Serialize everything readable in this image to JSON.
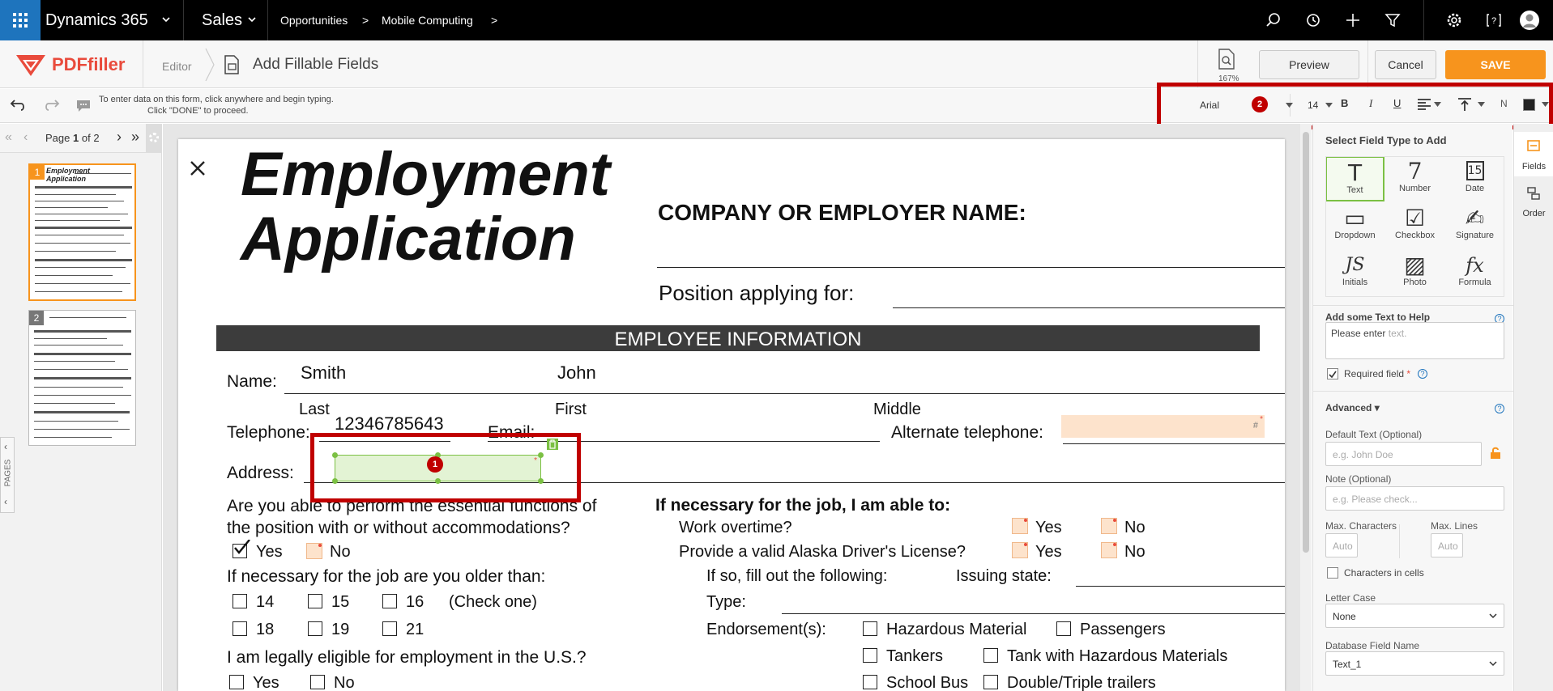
{
  "topnav": {
    "app_name": "Dynamics 365",
    "module": "Sales",
    "breadcrumb": [
      "Opportunities",
      "Mobile Computing"
    ]
  },
  "header": {
    "logo_text": "PDFfiller",
    "editor_label": "Editor",
    "page_title": "Add Fillable Fields",
    "zoom": "167%",
    "preview_label": "Preview",
    "cancel_label": "Cancel",
    "save_label": "SAVE"
  },
  "toolbar": {
    "hint_line1": "To enter data on this form, click anywhere and begin typing.",
    "hint_line2": "Click \"DONE\" to proceed.",
    "font": "Arial",
    "font_size": "14",
    "bold": "B",
    "italic": "I",
    "underline": "U",
    "n_label": "N",
    "annotation_badge": "2"
  },
  "pagenav": {
    "prefix": "Page",
    "current": "1",
    "suffix": "of 2"
  },
  "thumbnails": [
    {
      "num": "1",
      "title": "Employment Application"
    },
    {
      "num": "2",
      "title": ""
    }
  ],
  "pages_tab_label": "PAGES",
  "document": {
    "title_line1": "Employment",
    "title_line2": "Application",
    "company_label": "COMPANY OR EMPLOYER NAME:",
    "position_label": "Position applying for:",
    "section_header": "EMPLOYEE INFORMATION",
    "name_label": "Name:",
    "name_last_value": "Smith",
    "name_first_value": "John",
    "last_caption": "Last",
    "first_caption": "First",
    "middle_caption": "Middle",
    "telephone_label": "Telephone:",
    "telephone_value": "12346785643",
    "email_label": "Email:",
    "alt_tel_label": "Alternate telephone:",
    "alt_field_hash": "#",
    "address_label": "Address:",
    "address_badge": "1",
    "q_able_line1": "Are you able to perform the essential functions of",
    "q_able_line2": "the position with or without accommodations?",
    "yes": "Yes",
    "no": "No",
    "q_older": "If necessary for the job are you older than:",
    "ages": [
      "14",
      "15",
      "16",
      "18",
      "19",
      "21"
    ],
    "check_one": "(Check one)",
    "q_legal": "I am legally eligible for employment in the U.S.?",
    "if_necessary_header": "If necessary for the job, I am able to:",
    "work_overtime": "Work overtime?",
    "drivers_license": "Provide a valid Alaska Driver's License?",
    "if_so": "If so, fill out the following:",
    "issuing_state": "Issuing state:",
    "type_label": "Type:",
    "endorsements_label": "Endorsement(s):",
    "endorsements": [
      "Hazardous Material",
      "Passengers",
      "Tankers",
      "Tank with Hazardous Materials",
      "School Bus",
      "Double/Triple trailers"
    ]
  },
  "panel": {
    "select_title": "Select Field Type to Add",
    "field_types": [
      {
        "label": "Text",
        "icon": "T"
      },
      {
        "label": "Number",
        "icon": "7"
      },
      {
        "label": "Date",
        "icon": "15"
      },
      {
        "label": "Dropdown",
        "icon": "▭"
      },
      {
        "label": "Checkbox",
        "icon": "☑"
      },
      {
        "label": "Signature",
        "icon": "✍"
      },
      {
        "label": "Initials",
        "icon": "JS"
      },
      {
        "label": "Photo",
        "icon": "▨"
      },
      {
        "label": "Formula",
        "icon": "fx"
      }
    ],
    "help_label": "Add some Text to Help",
    "help_placeholder_main": "Please enter",
    "help_placeholder_suffix": "text.",
    "required_label": "Required field",
    "advanced_label": "Advanced",
    "default_text_label": "Default Text (Optional)",
    "default_text_placeholder": "e.g. John Doe",
    "note_label": "Note (Optional)",
    "note_placeholder": "e.g. Please check...",
    "max_chars_label": "Max. Characters",
    "max_lines_label": "Max. Lines",
    "auto": "Auto",
    "chars_in_cells": "Characters in cells",
    "letter_case_label": "Letter Case",
    "letter_case_value": "None",
    "db_field_label": "Database Field Name",
    "db_field_value": "Text_1"
  },
  "rtabs": {
    "fields": "Fields",
    "order": "Order"
  },
  "colors": {
    "accent": "#1e74bd",
    "save": "#f7941d",
    "annotation": "#c00000",
    "field_green": "#e3f3d4",
    "field_orange": "#fde3cc"
  }
}
